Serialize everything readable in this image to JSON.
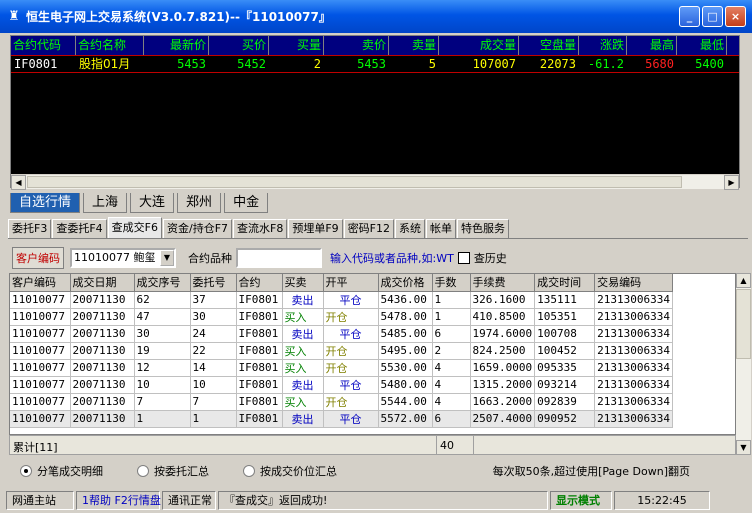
{
  "window": {
    "title": "恒生电子网上交易系统(V3.0.7.821)--『11010077』",
    "min": "_",
    "max": "□",
    "close": "×"
  },
  "quote": {
    "headers": [
      "合约代码",
      "合约名称",
      "最新价",
      "买价",
      "买量",
      "卖价",
      "卖量",
      "成交量",
      "空盘量",
      "涨跌",
      "最高",
      "最低"
    ],
    "row": [
      "IF0801",
      "股指01月",
      "5453",
      "5452",
      "2",
      "5453",
      "5",
      "107007",
      "22073",
      "-61.2",
      "5680",
      "5400"
    ]
  },
  "market_tabs": [
    "自选行情",
    "上海",
    "大连",
    "郑州",
    "中金"
  ],
  "func_tabs": [
    "委托F3",
    "查委托F4",
    "查成交F6",
    "资金/持仓F7",
    "查流水F8",
    "预埋单F9",
    "密码F12",
    "系统",
    "帐单",
    "特色服务"
  ],
  "filter": {
    "cust_label": "客户编码",
    "cust_value": "11010077 鲍玺",
    "contract_label": "合约品种",
    "hint": "输入代码或者品种,如:WT",
    "history_label": "查历史"
  },
  "grid": {
    "headers": [
      "客户编码",
      "成交日期",
      "成交序号",
      "委托号",
      "合约",
      "买卖",
      "开平",
      "成交价格",
      "手数",
      "手续费",
      "成交时间",
      "交易编码"
    ],
    "rows": [
      [
        "11010077",
        "20071130",
        "62",
        "37",
        "IF0801",
        "卖出",
        "平仓",
        "5436.00",
        "1",
        "326.1600",
        "135111",
        "21313006334"
      ],
      [
        "11010077",
        "20071130",
        "47",
        "30",
        "IF0801",
        "买入",
        "开仓",
        "5478.00",
        "1",
        "410.8500",
        "105351",
        "21313006334"
      ],
      [
        "11010077",
        "20071130",
        "30",
        "24",
        "IF0801",
        "卖出",
        "平仓",
        "5485.00",
        "6",
        "1974.6000",
        "100708",
        "21313006334"
      ],
      [
        "11010077",
        "20071130",
        "19",
        "22",
        "IF0801",
        "买入",
        "开仓",
        "5495.00",
        "2",
        "824.2500",
        "100452",
        "21313006334"
      ],
      [
        "11010077",
        "20071130",
        "12",
        "14",
        "IF0801",
        "买入",
        "开仓",
        "5530.00",
        "4",
        "1659.0000",
        "095335",
        "21313006334"
      ],
      [
        "11010077",
        "20071130",
        "10",
        "10",
        "IF0801",
        "卖出",
        "平仓",
        "5480.00",
        "4",
        "1315.2000",
        "093214",
        "21313006334"
      ],
      [
        "11010077",
        "20071130",
        "7",
        "7",
        "IF0801",
        "买入",
        "开仓",
        "5544.00",
        "4",
        "1663.2000",
        "092839",
        "21313006334"
      ],
      [
        "11010077",
        "20071130",
        "1",
        "1",
        "IF0801",
        "卖出",
        "平仓",
        "5572.00",
        "6",
        "2507.4000",
        "090952",
        "21313006334"
      ]
    ]
  },
  "summary": {
    "label": "累计[11]",
    "total_lots": "40"
  },
  "options": {
    "opt1": "分笔成交明细",
    "opt2": "按委托汇总",
    "opt3": "按成交价位汇总",
    "page_hint": "每次取50条,超过使用[Page Down]翻页"
  },
  "status": {
    "station": "网通主站",
    "help": "1帮助 F2行情盘",
    "conn": "通讯正常",
    "msg": "『查成交』返回成功!",
    "mode": "显示模式",
    "time": "15:22:45"
  }
}
